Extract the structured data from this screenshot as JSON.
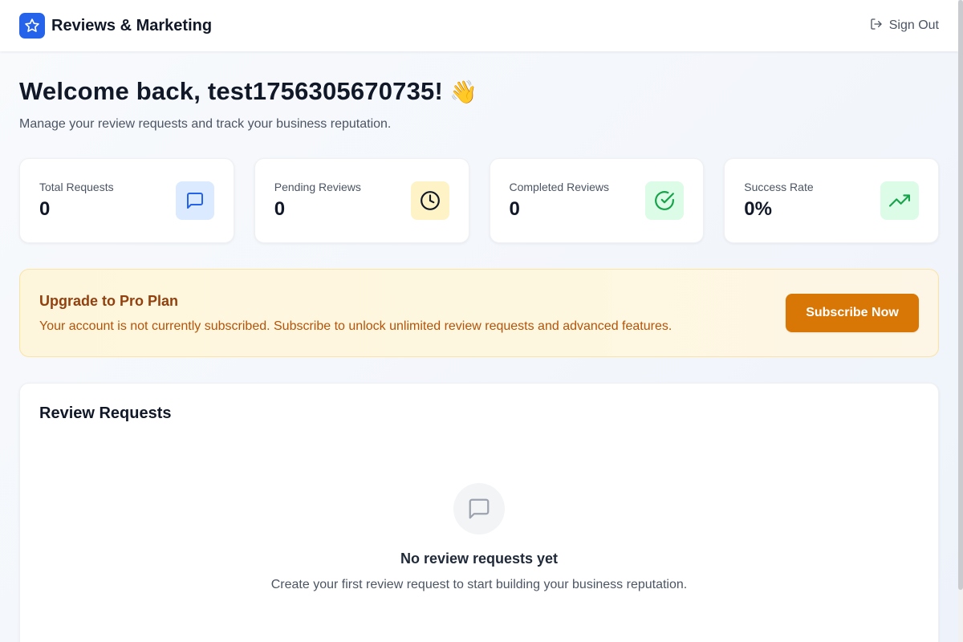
{
  "header": {
    "brand_title": "Reviews & Marketing",
    "brand_icon": "star-icon",
    "sign_out_label": "Sign Out",
    "sign_out_icon": "log-out-icon"
  },
  "welcome": {
    "title": "Welcome back, test1756305670735!",
    "wave_emoji": "👋",
    "subtitle": "Manage your review requests and track your business reputation."
  },
  "stats": [
    {
      "label": "Total Requests",
      "value": "0",
      "icon": "message-square-icon",
      "icon_bg": "#dbeafe",
      "icon_color": "#2563eb"
    },
    {
      "label": "Pending Reviews",
      "value": "0",
      "icon": "clock-icon",
      "icon_bg": "#fef3c7",
      "icon_color": "#111827"
    },
    {
      "label": "Completed Reviews",
      "value": "0",
      "icon": "check-circle-icon",
      "icon_bg": "#dcfce7",
      "icon_color": "#16a34a"
    },
    {
      "label": "Success Rate",
      "value": "0%",
      "icon": "trending-up-icon",
      "icon_bg": "#dcfce7",
      "icon_color": "#16a34a"
    }
  ],
  "upgrade": {
    "title": "Upgrade to Pro Plan",
    "text": "Your account is not currently subscribed. Subscribe to unlock unlimited review requests and advanced features.",
    "button_label": "Subscribe Now"
  },
  "requests": {
    "title": "Review Requests",
    "empty_title": "No review requests yet",
    "empty_text": "Create your first review request to start building your business reputation.",
    "empty_icon": "message-square-icon"
  },
  "colors": {
    "brand": "#2563eb",
    "accent_button": "#d97706",
    "banner_title": "#92400e",
    "banner_text": "#b45309"
  }
}
